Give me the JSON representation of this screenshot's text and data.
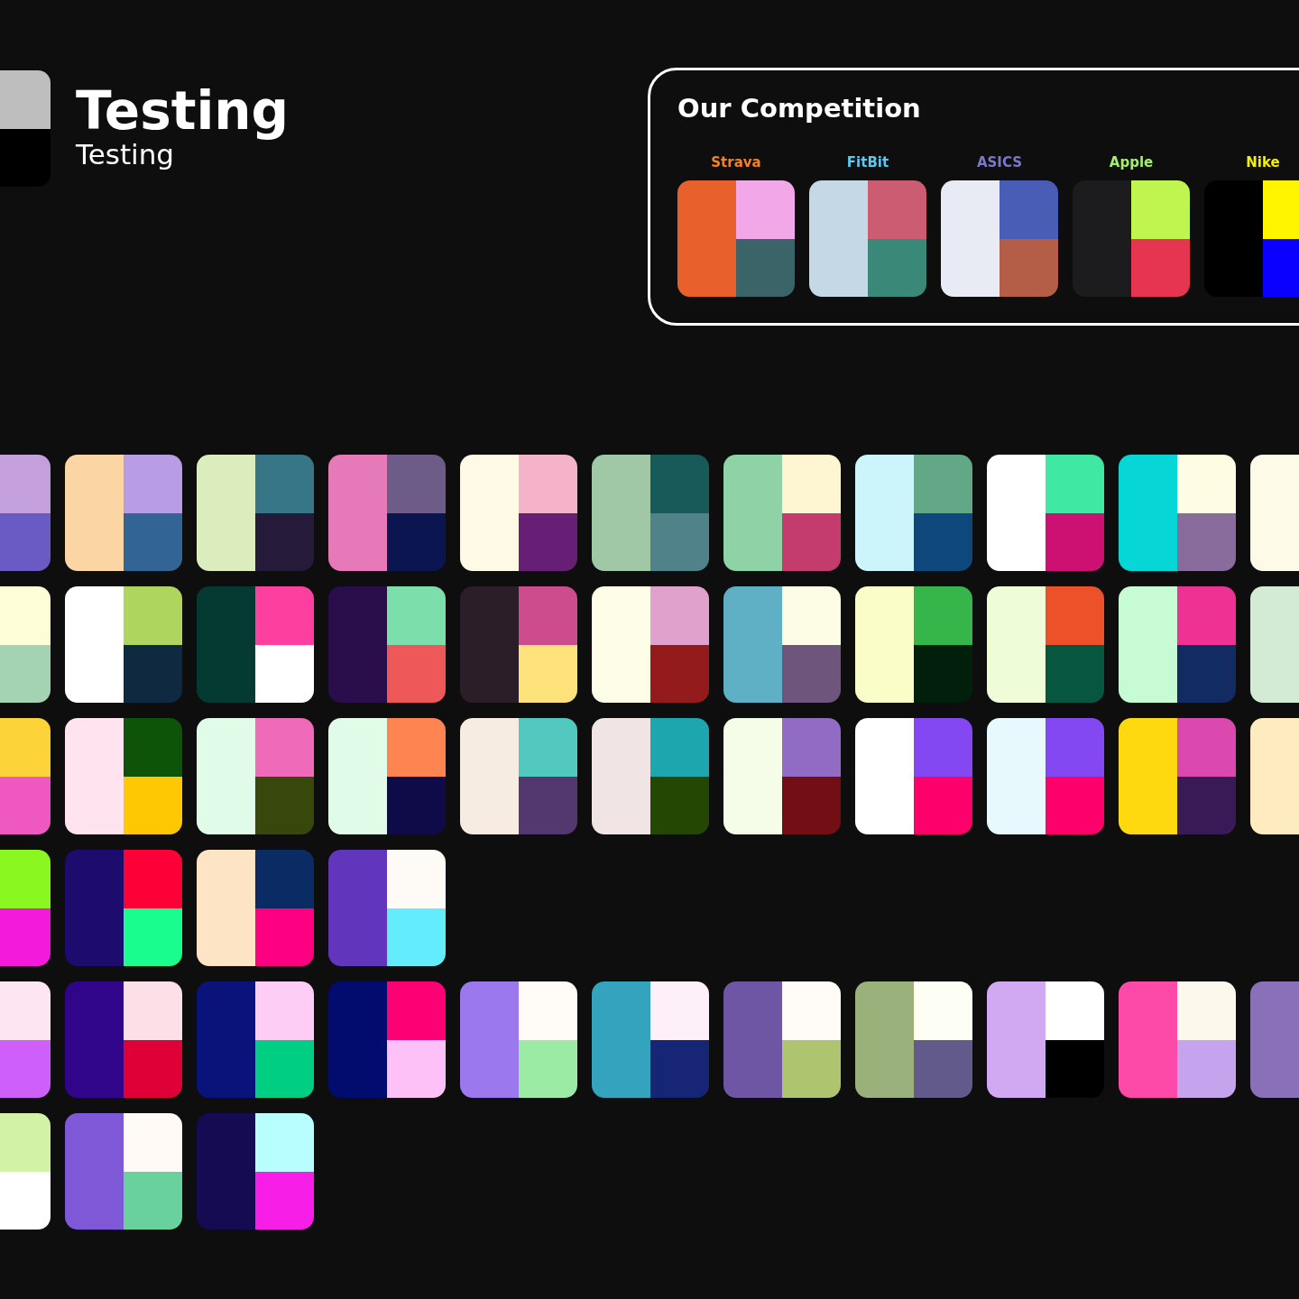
{
  "header": {
    "title": "Testing",
    "subtitle": "Testing",
    "swatch": [
      {
        "kind": "top",
        "color": "#bebebe"
      },
      {
        "kind": "bottom",
        "color": "#000000"
      }
    ]
  },
  "competition": {
    "title": "Our Competition",
    "brands": [
      {
        "name": "Strava",
        "color": "#f5821f",
        "swatch": [
          {
            "kind": "left",
            "color": "#e8602c"
          },
          {
            "kind": "top",
            "color": "#f2a8e8"
          },
          {
            "kind": "bottom",
            "color": "#3b6469"
          }
        ]
      },
      {
        "name": "FitBit",
        "color": "#5bc8ef",
        "swatch": [
          {
            "kind": "left",
            "color": "#c4d8e6"
          },
          {
            "kind": "top",
            "color": "#cc5c72"
          },
          {
            "kind": "bottom",
            "color": "#3a8878"
          }
        ]
      },
      {
        "name": "ASICS",
        "color": "#7b78c8",
        "swatch": [
          {
            "kind": "left",
            "color": "#e8eaf4"
          },
          {
            "kind": "top",
            "color": "#4a5db6"
          },
          {
            "kind": "bottom",
            "color": "#b45e48"
          }
        ]
      },
      {
        "name": "Apple",
        "color": "#a3ee6a",
        "swatch": [
          {
            "kind": "left",
            "color": "#1c1c1e"
          },
          {
            "kind": "top",
            "color": "#bff54e"
          },
          {
            "kind": "bottom",
            "color": "#e63550"
          }
        ]
      },
      {
        "name": "Nike",
        "color": "#f4f000",
        "swatch": [
          {
            "kind": "left",
            "color": "#000000"
          },
          {
            "kind": "top",
            "color": "#fff500"
          },
          {
            "kind": "bottom",
            "color": "#0a00ff"
          }
        ]
      }
    ]
  },
  "palette_rows": [
    [
      [
        {
          "kind": "top",
          "color": "#c3a0dc"
        },
        {
          "kind": "bottom",
          "color": "#6a5ac4"
        }
      ],
      [
        {
          "kind": "left",
          "color": "#fcd5a5"
        },
        {
          "kind": "top",
          "color": "#b89de6"
        },
        {
          "kind": "bottom",
          "color": "#336496"
        }
      ],
      [
        {
          "kind": "left",
          "color": "#dcedbd"
        },
        {
          "kind": "top",
          "color": "#377686"
        },
        {
          "kind": "bottom",
          "color": "#251a3a"
        }
      ],
      [
        {
          "kind": "left",
          "color": "#e67ab8"
        },
        {
          "kind": "top",
          "color": "#6e5c88"
        },
        {
          "kind": "bottom",
          "color": "#0b1651"
        }
      ],
      [
        {
          "kind": "left",
          "color": "#fefae5"
        },
        {
          "kind": "top",
          "color": "#f4b3c8"
        },
        {
          "kind": "bottom",
          "color": "#661f75"
        }
      ],
      [
        {
          "kind": "left",
          "color": "#a1c8a6"
        },
        {
          "kind": "top",
          "color": "#185a5a"
        },
        {
          "kind": "bottom",
          "color": "#508389"
        }
      ],
      [
        {
          "kind": "left",
          "color": "#8ed2a5"
        },
        {
          "kind": "top",
          "color": "#fef6d3"
        },
        {
          "kind": "bottom",
          "color": "#c43b6d"
        }
      ],
      [
        {
          "kind": "left",
          "color": "#ccf5fb"
        },
        {
          "kind": "top",
          "color": "#62a887"
        },
        {
          "kind": "bottom",
          "color": "#0e477c"
        }
      ],
      [
        {
          "kind": "left",
          "color": "#ffffff"
        },
        {
          "kind": "top",
          "color": "#3fe9a4"
        },
        {
          "kind": "bottom",
          "color": "#cc1173"
        }
      ],
      [
        {
          "kind": "left",
          "color": "#07d6d6"
        },
        {
          "kind": "top",
          "color": "#fefde4"
        },
        {
          "kind": "bottom",
          "color": "#8a6c9c"
        }
      ],
      [
        {
          "kind": "left",
          "color": "#fefae8"
        }
      ]
    ],
    [
      [
        {
          "kind": "top",
          "color": "#fdfdd8"
        },
        {
          "kind": "bottom",
          "color": "#a4d3b3"
        }
      ],
      [
        {
          "kind": "left",
          "color": "#ffffff"
        },
        {
          "kind": "top",
          "color": "#aed65e"
        },
        {
          "kind": "bottom",
          "color": "#0f2a40"
        }
      ],
      [
        {
          "kind": "left",
          "color": "#053a33"
        },
        {
          "kind": "top",
          "color": "#fd40a0"
        },
        {
          "kind": "bottom",
          "color": "#ffffff"
        }
      ],
      [
        {
          "kind": "left",
          "color": "#2a0e4c"
        },
        {
          "kind": "top",
          "color": "#7cdeaa"
        },
        {
          "kind": "bottom",
          "color": "#ef5858"
        }
      ],
      [
        {
          "kind": "left",
          "color": "#2c1e28"
        },
        {
          "kind": "top",
          "color": "#cc4c8e"
        },
        {
          "kind": "bottom",
          "color": "#fde17b"
        }
      ],
      [
        {
          "kind": "left",
          "color": "#fdfde8"
        },
        {
          "kind": "top",
          "color": "#e0a2cc"
        },
        {
          "kind": "bottom",
          "color": "#931b1c"
        }
      ],
      [
        {
          "kind": "left",
          "color": "#5fb0c4"
        },
        {
          "kind": "top",
          "color": "#fdfde5"
        },
        {
          "kind": "bottom",
          "color": "#6d557b"
        }
      ],
      [
        {
          "kind": "left",
          "color": "#fafdc7"
        },
        {
          "kind": "top",
          "color": "#36b54b"
        },
        {
          "kind": "bottom",
          "color": "#011f0b"
        }
      ],
      [
        {
          "kind": "left",
          "color": "#effcd8"
        },
        {
          "kind": "top",
          "color": "#ec512a"
        },
        {
          "kind": "bottom",
          "color": "#075640"
        }
      ],
      [
        {
          "kind": "left",
          "color": "#c7fbd3"
        },
        {
          "kind": "top",
          "color": "#ee3294"
        },
        {
          "kind": "bottom",
          "color": "#122b60"
        }
      ],
      [
        {
          "kind": "left",
          "color": "#d3ebd5"
        }
      ]
    ],
    [
      [
        {
          "kind": "top",
          "color": "#fdd33a"
        },
        {
          "kind": "bottom",
          "color": "#ee58c0"
        }
      ],
      [
        {
          "kind": "left",
          "color": "#ffe4f0"
        },
        {
          "kind": "top",
          "color": "#0d5408"
        },
        {
          "kind": "bottom",
          "color": "#fec803"
        }
      ],
      [
        {
          "kind": "left",
          "color": "#e0fbe8"
        },
        {
          "kind": "top",
          "color": "#ef6bb9"
        },
        {
          "kind": "bottom",
          "color": "#38480c"
        }
      ],
      [
        {
          "kind": "left",
          "color": "#e0fbe8"
        },
        {
          "kind": "top",
          "color": "#fe8451"
        },
        {
          "kind": "bottom",
          "color": "#0f0a48"
        }
      ],
      [
        {
          "kind": "left",
          "color": "#f6ece2"
        },
        {
          "kind": "top",
          "color": "#52c9be"
        },
        {
          "kind": "bottom",
          "color": "#533870"
        }
      ],
      [
        {
          "kind": "left",
          "color": "#f0e4e4"
        },
        {
          "kind": "top",
          "color": "#1ea6ae"
        },
        {
          "kind": "bottom",
          "color": "#244704"
        }
      ],
      [
        {
          "kind": "left",
          "color": "#f5fde8"
        },
        {
          "kind": "top",
          "color": "#916bc4"
        },
        {
          "kind": "bottom",
          "color": "#720f14"
        }
      ],
      [
        {
          "kind": "left",
          "color": "#ffffff"
        },
        {
          "kind": "top",
          "color": "#8448f2"
        },
        {
          "kind": "bottom",
          "color": "#fe006b"
        }
      ],
      [
        {
          "kind": "left",
          "color": "#e8f9fd"
        },
        {
          "kind": "top",
          "color": "#8448f2"
        },
        {
          "kind": "bottom",
          "color": "#fe006b"
        }
      ],
      [
        {
          "kind": "left",
          "color": "#ffd910"
        },
        {
          "kind": "top",
          "color": "#da48b0"
        },
        {
          "kind": "bottom",
          "color": "#3a1a56"
        }
      ],
      [
        {
          "kind": "left",
          "color": "#feebc0"
        }
      ]
    ],
    [
      [
        {
          "kind": "top",
          "color": "#8bf720"
        },
        {
          "kind": "bottom",
          "color": "#f31adb"
        }
      ],
      [
        {
          "kind": "left",
          "color": "#1e0b6e"
        },
        {
          "kind": "top",
          "color": "#fe0038"
        },
        {
          "kind": "bottom",
          "color": "#18fd8d"
        }
      ],
      [
        {
          "kind": "left",
          "color": "#fde4c4"
        },
        {
          "kind": "top",
          "color": "#0b2b64"
        },
        {
          "kind": "bottom",
          "color": "#fd0081"
        }
      ],
      [
        {
          "kind": "left",
          "color": "#6236bc"
        },
        {
          "kind": "top",
          "color": "#fefbf7"
        },
        {
          "kind": "bottom",
          "color": "#63ecfc"
        }
      ]
    ],
    [
      [
        {
          "kind": "top",
          "color": "#fde5f2"
        },
        {
          "kind": "bottom",
          "color": "#cf5ff9"
        }
      ],
      [
        {
          "kind": "left",
          "color": "#310589"
        },
        {
          "kind": "top",
          "color": "#fce0e7"
        },
        {
          "kind": "bottom",
          "color": "#de0037"
        }
      ],
      [
        {
          "kind": "left",
          "color": "#0a1379"
        },
        {
          "kind": "top",
          "color": "#fdcdf5"
        },
        {
          "kind": "bottom",
          "color": "#00cf83"
        }
      ],
      [
        {
          "kind": "left",
          "color": "#020c6e"
        },
        {
          "kind": "top",
          "color": "#fd0073"
        },
        {
          "kind": "bottom",
          "color": "#fdc1f8"
        }
      ],
      [
        {
          "kind": "left",
          "color": "#9c78ee"
        },
        {
          "kind": "top",
          "color": "#fffcf8"
        },
        {
          "kind": "bottom",
          "color": "#9ceba4"
        }
      ],
      [
        {
          "kind": "left",
          "color": "#34a3be"
        },
        {
          "kind": "top",
          "color": "#fdf0f8"
        },
        {
          "kind": "bottom",
          "color": "#162576"
        }
      ],
      [
        {
          "kind": "left",
          "color": "#6e56a4"
        },
        {
          "kind": "top",
          "color": "#fffcf8"
        },
        {
          "kind": "bottom",
          "color": "#aec46f"
        }
      ],
      [
        {
          "kind": "left",
          "color": "#9bb17c"
        },
        {
          "kind": "top",
          "color": "#fdfff4"
        },
        {
          "kind": "bottom",
          "color": "#635a8c"
        }
      ],
      [
        {
          "kind": "left",
          "color": "#d1a9f3"
        },
        {
          "kind": "top",
          "color": "#ffffff"
        },
        {
          "kind": "bottom",
          "color": "#000000"
        }
      ],
      [
        {
          "kind": "left",
          "color": "#fd4aa9"
        },
        {
          "kind": "top",
          "color": "#fdf8ec"
        },
        {
          "kind": "bottom",
          "color": "#c6a4ed"
        }
      ],
      [
        {
          "kind": "left",
          "color": "#8a70b8"
        }
      ]
    ],
    [
      [
        {
          "kind": "top",
          "color": "#d2f2a6"
        },
        {
          "kind": "bottom",
          "color": "#ffffff"
        }
      ],
      [
        {
          "kind": "left",
          "color": "#7f58d8"
        },
        {
          "kind": "top",
          "color": "#fffaf6"
        },
        {
          "kind": "bottom",
          "color": "#69d19d"
        }
      ],
      [
        {
          "kind": "left",
          "color": "#140b52"
        },
        {
          "kind": "top",
          "color": "#b8fefe"
        },
        {
          "kind": "bottom",
          "color": "#f71ee8"
        }
      ]
    ]
  ]
}
